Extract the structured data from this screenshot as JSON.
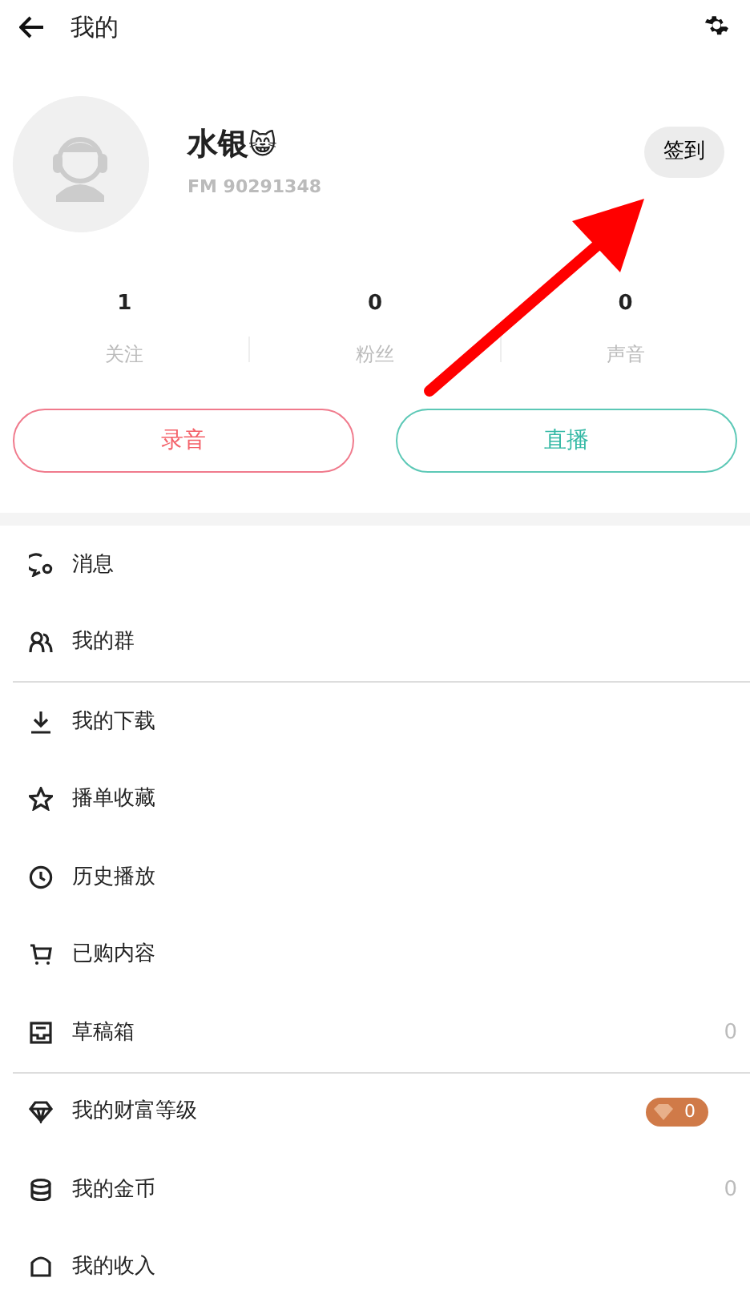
{
  "header": {
    "title": "我的"
  },
  "profile": {
    "name": "水银",
    "emoji": "😸",
    "id_text": "FM 90291348",
    "checkin_button": "签到"
  },
  "stats": [
    {
      "value": "1",
      "label": "关注"
    },
    {
      "value": "0",
      "label": "粉丝"
    },
    {
      "value": "0",
      "label": "声音"
    }
  ],
  "actions": [
    {
      "label": "录音",
      "kind": "record"
    },
    {
      "label": "直播",
      "kind": "live"
    }
  ],
  "menu_sections": [
    {
      "items": [
        {
          "label": "消息",
          "kind": "plain"
        },
        {
          "label": "我的群",
          "kind": "plain"
        }
      ]
    },
    {
      "items": [
        {
          "label": "我的下载",
          "kind": "plain"
        },
        {
          "label": "播单收藏",
          "kind": "plain"
        },
        {
          "label": "历史播放",
          "kind": "plain"
        },
        {
          "label": "已购内容",
          "kind": "plain"
        },
        {
          "label": "草稿箱",
          "kind": "count",
          "value": "0"
        }
      ]
    },
    {
      "items": [
        {
          "label": "我的财富等级",
          "kind": "badge",
          "value": "0"
        },
        {
          "label": "我的金币",
          "kind": "count",
          "value": "0"
        },
        {
          "label": "我的收入",
          "kind": "plain"
        }
      ]
    }
  ]
}
